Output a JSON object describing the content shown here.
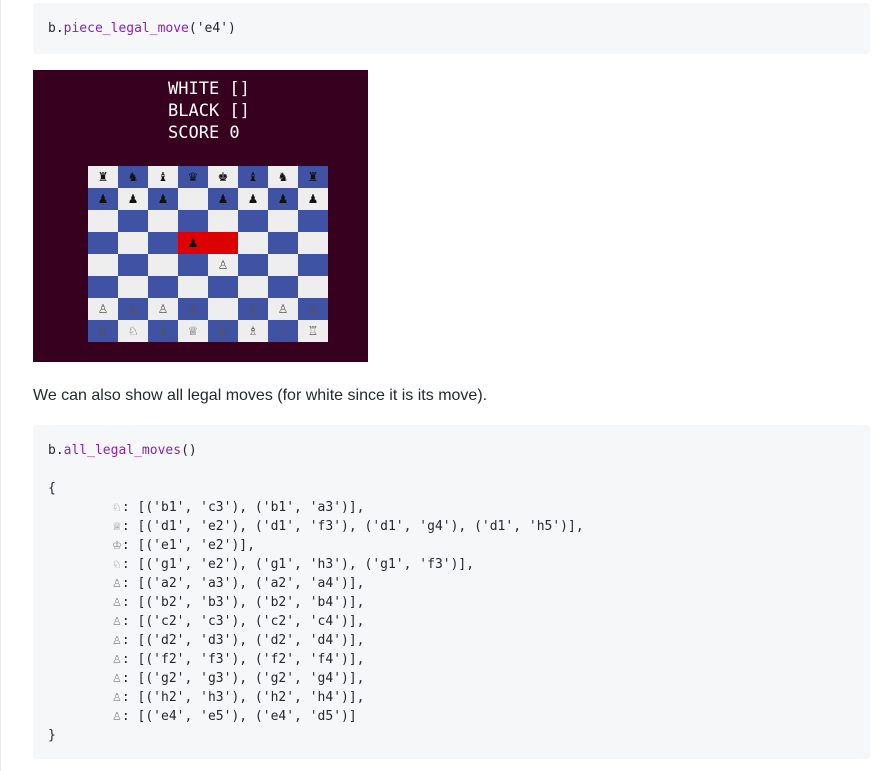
{
  "cell1": {
    "object": "b",
    "dot": ".",
    "method": "piece_legal_move",
    "args": "('e4')"
  },
  "game": {
    "white_line": "WHITE []",
    "black_line": "BLACK []",
    "score_line": "SCORE 0",
    "colors": {
      "background": "#38001f",
      "light": "#eeeeee",
      "dark": "#3f52a4",
      "highlight": "#dd0000"
    },
    "rows": [
      [
        "♜",
        "♞",
        "♝",
        "♛",
        "♚",
        "♝",
        "♞",
        "♜"
      ],
      [
        "♟",
        "♟",
        "♟",
        "",
        "♟",
        "♟",
        "♟",
        "♟"
      ],
      [
        "",
        "",
        "",
        "",
        "",
        "",
        "",
        ""
      ],
      [
        "",
        "",
        "",
        "♟",
        "",
        "",
        "",
        ""
      ],
      [
        "",
        "",
        "",
        "",
        "♙",
        "",
        "",
        ""
      ],
      [
        "",
        "",
        "",
        "",
        "",
        "",
        "",
        ""
      ],
      [
        "♙",
        "♙",
        "♙",
        "♙",
        "",
        "♙",
        "♙",
        "♙"
      ],
      [
        "♖",
        "♘",
        "♗",
        "♕",
        "♔",
        "♗",
        "♘",
        "♖"
      ]
    ],
    "highlighted": [
      [
        3,
        3
      ],
      [
        3,
        4
      ]
    ]
  },
  "prose": "We can also show all legal moves (for white since it is its move).",
  "cell2": {
    "object": "b",
    "dot": ".",
    "method": "all_legal_moves",
    "args": "()",
    "open_brace": "{",
    "close_brace": "}",
    "entries": [
      {
        "piece": "♘",
        "moves": ": [('b1', 'c3'), ('b1', 'a3')],"
      },
      {
        "piece": "♕",
        "moves": ": [('d1', 'e2'), ('d1', 'f3'), ('d1', 'g4'), ('d1', 'h5')],"
      },
      {
        "piece": "♔",
        "moves": ": [('e1', 'e2')],"
      },
      {
        "piece": "♘",
        "moves": ": [('g1', 'e2'), ('g1', 'h3'), ('g1', 'f3')],"
      },
      {
        "piece": "♙",
        "moves": ": [('a2', 'a3'), ('a2', 'a4')],"
      },
      {
        "piece": "♙",
        "moves": ": [('b2', 'b3'), ('b2', 'b4')],"
      },
      {
        "piece": "♙",
        "moves": ": [('c2', 'c3'), ('c2', 'c4')],"
      },
      {
        "piece": "♙",
        "moves": ": [('d2', 'd3'), ('d2', 'd4')],"
      },
      {
        "piece": "♙",
        "moves": ": [('f2', 'f3'), ('f2', 'f4')],"
      },
      {
        "piece": "♙",
        "moves": ": [('g2', 'g3'), ('g2', 'g4')],"
      },
      {
        "piece": "♙",
        "moves": ": [('h2', 'h3'), ('h2', 'h4')],"
      },
      {
        "piece": "♙",
        "moves": ": [('e4', 'e5'), ('e4', 'd5')]"
      }
    ]
  }
}
